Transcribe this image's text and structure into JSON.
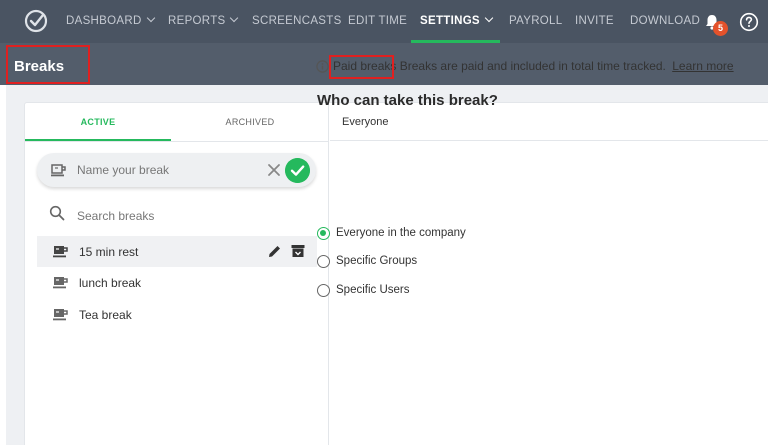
{
  "nav": {
    "items": [
      {
        "label": "DASHBOARD",
        "dropdown": true
      },
      {
        "label": "REPORTS",
        "dropdown": true
      },
      {
        "label": "SCREENCASTS",
        "dropdown": false
      },
      {
        "label": "EDIT TIME",
        "dropdown": false
      },
      {
        "label": "SETTINGS",
        "dropdown": true,
        "active": true
      },
      {
        "label": "PAYROLL",
        "dropdown": false
      },
      {
        "label": "INVITE",
        "dropdown": false
      },
      {
        "label": "DOWNLOAD",
        "dropdown": false
      }
    ],
    "notification_count": "5",
    "icons": {
      "logo": "checkmark-clock-logo",
      "bell": "bell-icon",
      "help": "question-circle-icon"
    }
  },
  "header": {
    "title": "Breaks"
  },
  "left_panel": {
    "tabs": {
      "active": "ACTIVE",
      "archived": "ARCHIVED"
    },
    "new_break_placeholder": "Name your break",
    "search_placeholder": "Search breaks",
    "breaks": [
      {
        "name": "15 min rest",
        "selected": true
      },
      {
        "name": "lunch break",
        "selected": false
      },
      {
        "name": "Tea break",
        "selected": false
      }
    ]
  },
  "right_panel": {
    "header": "Everyone",
    "paid_label": "Paid breaks",
    "paid_desc": "Breaks are paid and included in total time tracked.",
    "learn_more": "Learn more",
    "question": "Who can take this break?",
    "options": [
      {
        "label": "Everyone in the company",
        "checked": true
      },
      {
        "label": "Specific Groups",
        "checked": false
      },
      {
        "label": "Specific Users",
        "checked": false
      }
    ]
  },
  "colors": {
    "accent": "#25b95d",
    "nav_bg": "#4a5462",
    "header_bg": "#535d6b",
    "highlight": "#e02020",
    "badge": "#e4522b"
  }
}
